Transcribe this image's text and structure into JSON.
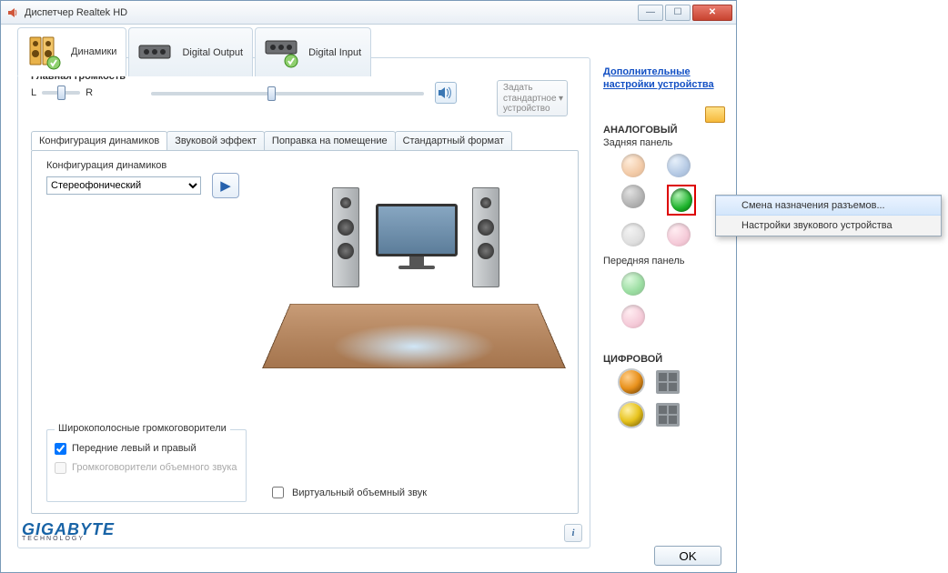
{
  "window": {
    "title": "Диспетчер Realtek HD"
  },
  "filetabs": {
    "speakers": "Динамики",
    "digital_out": "Digital Output",
    "digital_in": "Digital Input"
  },
  "volume": {
    "header": "Главная громкость",
    "l": "L",
    "r": "R"
  },
  "default_btn": "Задать стандартное устройство",
  "subtabs": {
    "cfg": "Конфигурация динамиков",
    "fx": "Звуковой эффект",
    "room": "Поправка на помещение",
    "fmt": "Стандартный формат"
  },
  "cfg": {
    "label": "Конфигурация динамиков",
    "selected": "Стереофонический"
  },
  "fullrange": {
    "header": "Широкополосные громкоговорители",
    "front": "Передние левый и правый",
    "surround": "Громкоговорители объемного звука"
  },
  "virtual": "Виртуальный объемный звук",
  "brand": {
    "name": "GIGABYTE",
    "sub": "TECHNOLOGY"
  },
  "right": {
    "adv_link": "Дополнительные настройки устройства",
    "analog": "АНАЛОГОВЫЙ",
    "rear": "Задняя панель",
    "front": "Передняя панель",
    "digital": "ЦИФРОВОЙ"
  },
  "ctx": {
    "reassign": "Смена назначения разъемов...",
    "settings": "Настройки звукового устройства"
  },
  "ok": "OK"
}
